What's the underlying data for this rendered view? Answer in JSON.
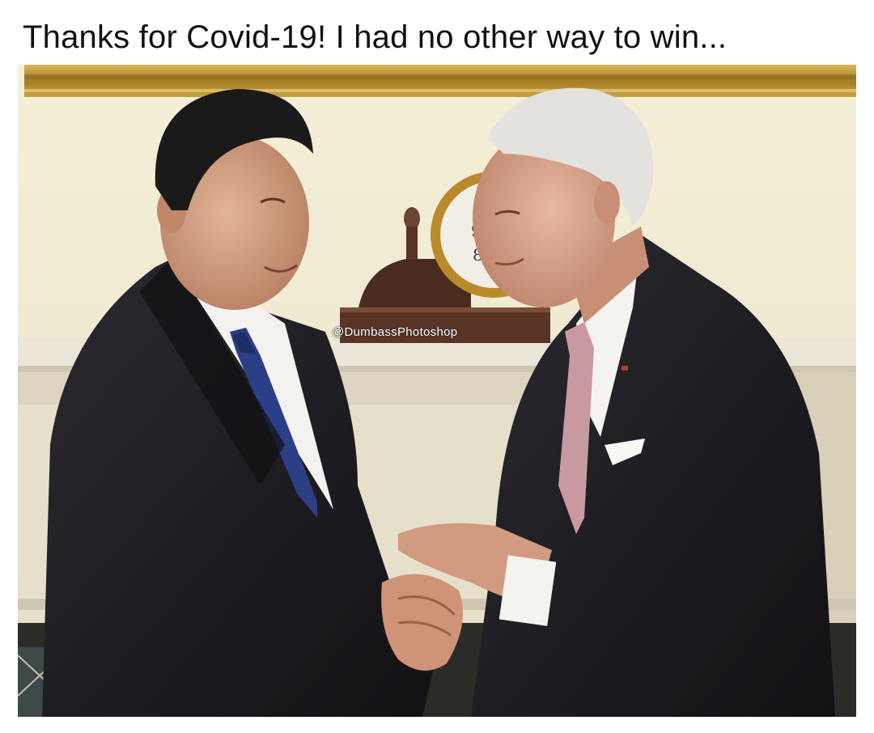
{
  "caption": "Thanks for Covid-19! I had no other way to win...",
  "watermark": "@DumbassPhotoshop",
  "colors": {
    "wall": "#f1ebd2",
    "frame_gold": "#b8902e",
    "mantel": "#ece7db",
    "suit": "#1c1c20",
    "left_tie": "#2c3f86",
    "right_tie": "#c89aa0",
    "skin": "#d8a488",
    "hair_left": "#1b1a1a",
    "hair_right": "#e4e2de"
  }
}
